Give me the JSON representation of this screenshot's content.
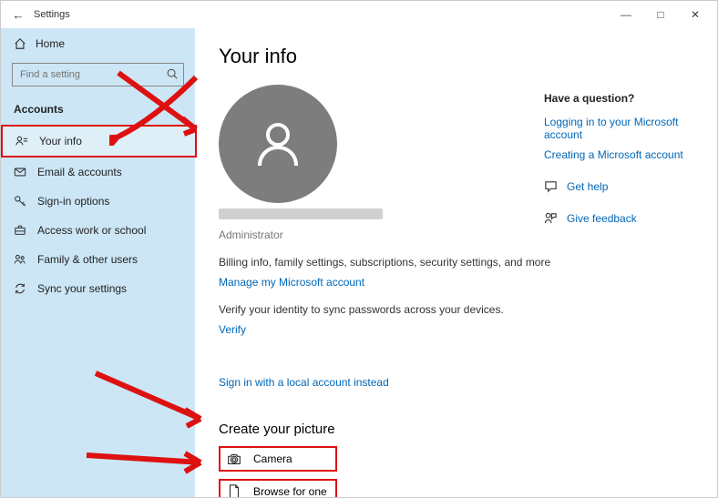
{
  "titlebar": {
    "title": "Settings"
  },
  "sidebar": {
    "home": "Home",
    "search_placeholder": "Find a setting",
    "section": "Accounts",
    "items": [
      {
        "label": "Your info"
      },
      {
        "label": "Email & accounts"
      },
      {
        "label": "Sign-in options"
      },
      {
        "label": "Access work or school"
      },
      {
        "label": "Family & other users"
      },
      {
        "label": "Sync your settings"
      }
    ]
  },
  "main": {
    "heading": "Your info",
    "role": "Administrator",
    "billing_text": "Billing info, family settings, subscriptions, security settings, and more",
    "manage_link": "Manage my Microsoft account",
    "verify_text": "Verify your identity to sync passwords across your devices.",
    "verify_link": "Verify",
    "local_link": "Sign in with a local account instead",
    "picture_heading": "Create your picture",
    "camera": "Camera",
    "browse": "Browse for one"
  },
  "right": {
    "question": "Have a question?",
    "link1": "Logging in to your Microsoft account",
    "link2": "Creating a Microsoft account",
    "gethelp": "Get help",
    "feedback": "Give feedback"
  }
}
